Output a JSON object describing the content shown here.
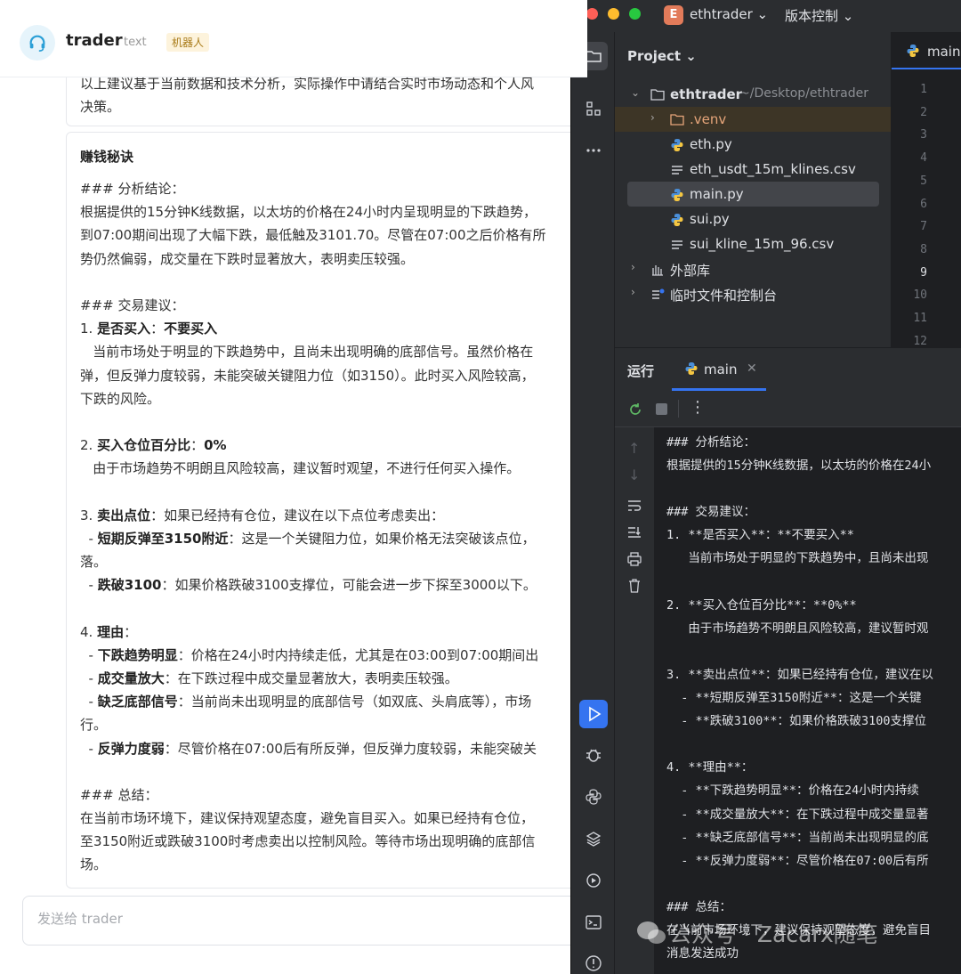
{
  "chat": {
    "bot_name": "trader",
    "bot_type": "text",
    "bot_badge": "机器人",
    "prev_message": "以上建议基于当前数据和技术分析，实际操作中请结合实时市场动态和个人风\n决策。",
    "card_title": "赚钱秘诀",
    "input_placeholder": "发送给 trader",
    "content": [
      {
        "t": "### 分析结论："
      },
      {
        "t": "根据提供的15分钟K线数据，以太坊的价格在24小时内呈现明显的下跌趋势，"
      },
      {
        "t": "到07:00期间出现了大幅下跌，最低触及3101.70。尽管在07:00之后价格有所"
      },
      {
        "t": "势仍然偏弱，成交量在下跌时显著放大，表明卖压较强。"
      },
      {
        "t": ""
      },
      {
        "t": "### 交易建议："
      },
      {
        "t": "1. ",
        "b": "是否买入",
        "m": "：",
        "b2": "不要买入"
      },
      {
        "t": "   当前市场处于明显的下跌趋势中，且尚未出现明确的底部信号。虽然价格在"
      },
      {
        "t": "弹，但反弹力度较弱，未能突破关键阻力位（如3150）。此时买入风险较高，"
      },
      {
        "t": "下跌的风险。"
      },
      {
        "t": ""
      },
      {
        "t": "2. ",
        "b": "买入仓位百分比",
        "m": "：",
        "b2": "0%"
      },
      {
        "t": "   由于市场趋势不明朗且风险较高，建议暂时观望，不进行任何买入操作。"
      },
      {
        "t": ""
      },
      {
        "t": "3. ",
        "b": "卖出点位",
        "m": "：如果已经持有仓位，建议在以下点位考虑卖出："
      },
      {
        "t": "  - ",
        "b": "短期反弹至3150附近",
        "m": "：这是一个关键阻力位，如果价格无法突破该点位，"
      },
      {
        "t": "落。"
      },
      {
        "t": "  - ",
        "b": "跌破3100",
        "m": "：如果价格跌破3100支撑位，可能会进一步下探至3000以下。"
      },
      {
        "t": ""
      },
      {
        "t": "4. ",
        "b": "理由",
        "m": "："
      },
      {
        "t": "  - ",
        "b": "下跌趋势明显",
        "m": "：价格在24小时内持续走低，尤其是在03:00到07:00期间出"
      },
      {
        "t": "  - ",
        "b": "成交量放大",
        "m": "：在下跌过程中成交量显著放大，表明卖压较强。"
      },
      {
        "t": "  - ",
        "b": "缺乏底部信号",
        "m": "：当前尚未出现明显的底部信号（如双底、头肩底等），市场"
      },
      {
        "t": "行。"
      },
      {
        "t": "  - ",
        "b": "反弹力度弱",
        "m": "：尽管价格在07:00后有所反弹，但反弹力度较弱，未能突破关"
      },
      {
        "t": ""
      },
      {
        "t": "### 总结："
      },
      {
        "t": "在当前市场环境下，建议保持观望态度，避免盲目买入。如果已经持有仓位，"
      },
      {
        "t": "至3150附近或跌破3100时考虑卖出以控制风险。等待市场出现明确的底部信"
      },
      {
        "t": "场。"
      }
    ]
  },
  "ide": {
    "project_badge": "E",
    "project_name": "ethtrader ⌄",
    "vcs_label": "版本控制 ⌄",
    "panel_title": "Project ⌄",
    "tree": [
      {
        "label": "ethtrader",
        "suffix": "~/Desktop/ethtrader",
        "icon": "folder-icon"
      },
      {
        "label": ".venv",
        "icon": "folder-icon"
      },
      {
        "label": "eth.py",
        "icon": "python-file-icon"
      },
      {
        "label": "eth_usdt_15m_klines.csv",
        "icon": "text-file-icon"
      },
      {
        "label": "main.py",
        "icon": "python-file-icon"
      },
      {
        "label": "sui.py",
        "icon": "python-file-icon"
      },
      {
        "label": "sui_kline_15m_96.csv",
        "icon": "text-file-icon"
      },
      {
        "label": "外部库",
        "icon": "library-icon"
      },
      {
        "label": "临时文件和控制台",
        "icon": "scratches-icon"
      }
    ],
    "editor_tab": "main.p",
    "line_numbers": [
      "1",
      "2",
      "3",
      "4",
      "5",
      "6",
      "7",
      "8",
      "9",
      "10",
      "11",
      "12"
    ],
    "current_line": "9",
    "run_title": "运行",
    "run_tab": "main",
    "console_lines": [
      "### 分析结论：",
      "根据提供的15分钟K线数据，以太坊的价格在24小",
      "",
      "### 交易建议：",
      "1. **是否买入**：**不要买入**",
      "   当前市场处于明显的下跌趋势中，且尚未出现",
      "",
      "2. **买入仓位百分比**：**0%**",
      "   由于市场趋势不明朗且风险较高，建议暂时观",
      "",
      "3. **卖出点位**：如果已经持有仓位，建议在以",
      "  - **短期反弹至3150附近**：这是一个关键",
      "  - **跌破3100**：如果价格跌破3100支撑位",
      "",
      "4. **理由**：",
      "  - **下跌趋势明显**：价格在24小时内持续",
      "  - **成交量放大**：在下跌过程中成交量显著",
      "  - **缺乏底部信号**：当前尚未出现明显的底",
      "  - **反弹力度弱**：尽管价格在07:00后有所",
      "",
      "### 总结：",
      "在当前市场环境下，建议保持观望态度，避免盲目",
      "消息发送成功"
    ]
  },
  "watermark": "公众号 · Zacarx随笔",
  "colors": {
    "accent": "#3574f0",
    "ide_bg": "#1e1f22",
    "panel_bg": "#2b2d30",
    "badge": "#e27b5a"
  }
}
